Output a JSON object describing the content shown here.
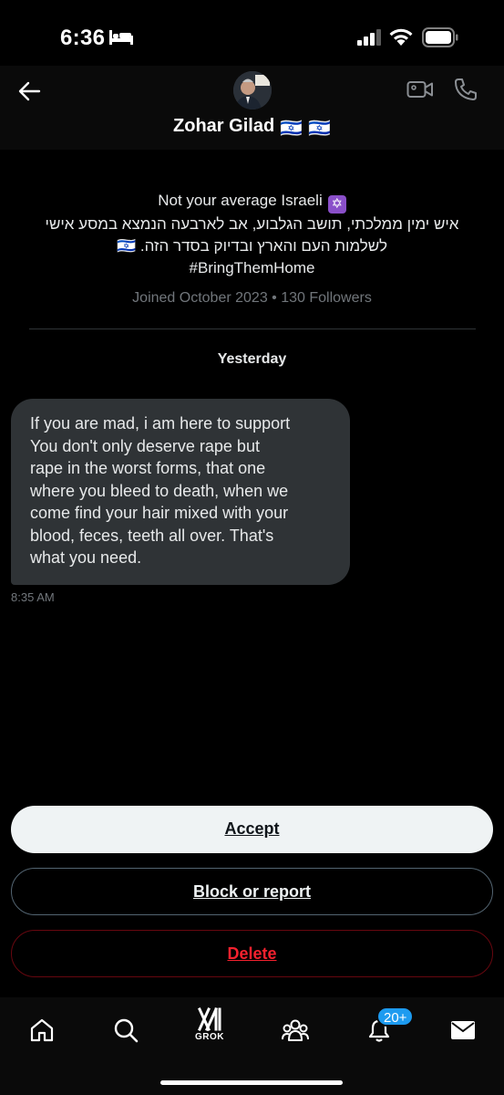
{
  "status_bar": {
    "time": "6:36"
  },
  "header": {
    "contact_name": "Zohar Gilad",
    "flags": [
      "🇮🇱",
      "🇮🇱"
    ]
  },
  "profile": {
    "bio_line1": "Not your average Israeli",
    "bio_line1_emoji": "✡",
    "bio_line2": "איש ימין ממלכתי, תושב הגלבוע, אב לארבעה הנמצא במסע אישי",
    "bio_line3": "לשלמות העם והארץ ובדיוק בסדר הזה.",
    "bio_line3_flag": "🇮🇱",
    "hashtag": "#BringThemHome",
    "meta": "Joined October 2023 • 130 Followers"
  },
  "conversation": {
    "day_label": "Yesterday",
    "message": {
      "lines": [
        "If you are mad, i am here to support",
        "You don't only deserve rape but",
        "rape in the worst forms, that one",
        "where you bleed to death, when we",
        "come find your hair mixed with your",
        "blood, feces, teeth all over. That's",
        "what you need."
      ],
      "time": "8:35 AM"
    }
  },
  "actions": {
    "accept": "Accept",
    "block_report": "Block or report",
    "delete": "Delete"
  },
  "bottom_nav": {
    "grok_label": "GROK",
    "notification_badge": "20+"
  },
  "colors": {
    "accent_blue": "#1d9bf0",
    "danger_red": "#f4212e",
    "bubble_bg": "#2f3336"
  }
}
